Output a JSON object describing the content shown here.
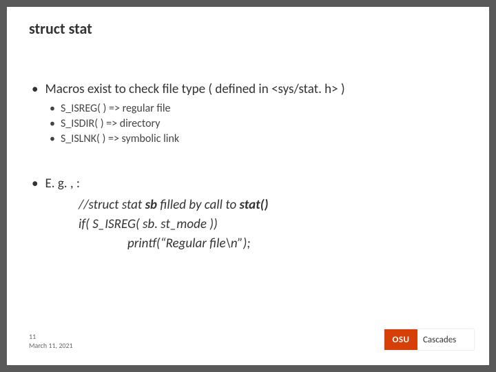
{
  "title": "struct stat",
  "bullets": {
    "main1": "Macros exist to check file type ( defined in <sys/stat. h> )",
    "sub1": "S_ISREG( ) => regular file",
    "sub2": "S_ISDIR( ) => directory",
    "sub3": "S_ISLNK( ) => symbolic link",
    "main2": "E. g. , :"
  },
  "code": {
    "l1a": "//struct stat ",
    "l1b": "sb",
    "l1c": " filled by call to ",
    "l1d": "stat()",
    "l2": "if( S_ISREG( sb. st_mode ))",
    "l3": "printf(“Regular file\\n”);"
  },
  "footer": {
    "num": "11",
    "date": "March 11, 2021"
  },
  "logo": {
    "left": "OSU",
    "right": "Cascades"
  }
}
